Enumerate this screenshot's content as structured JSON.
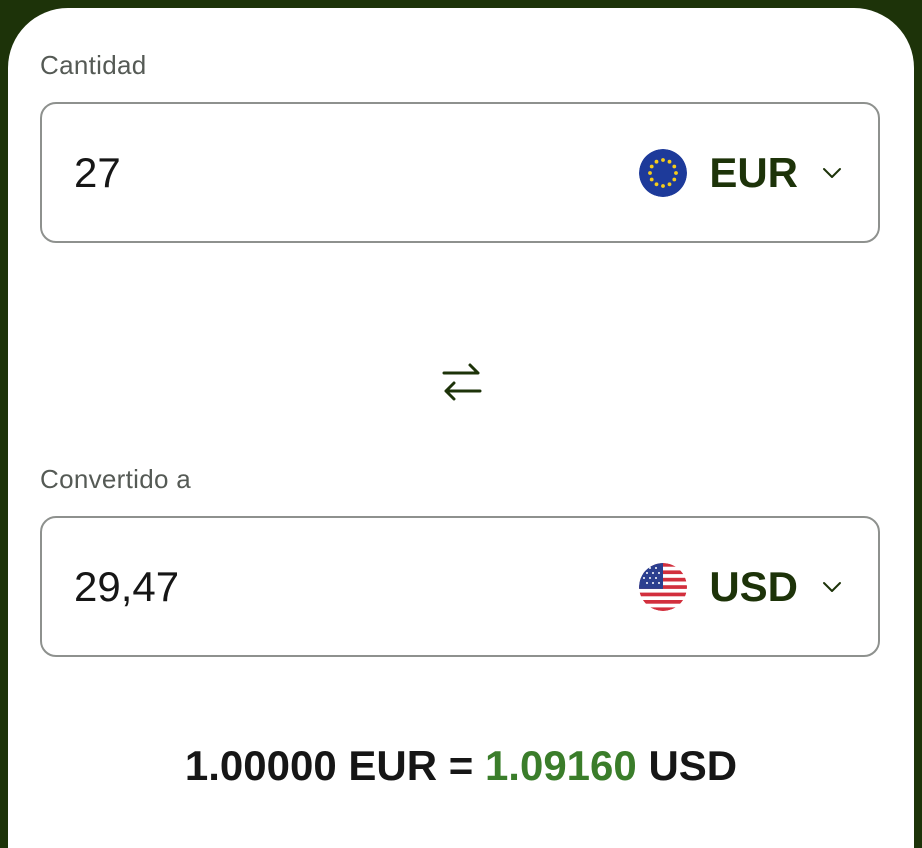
{
  "from": {
    "label": "Cantidad",
    "amount": "27",
    "currency": "EUR",
    "flag_icon": "eu-flag-icon"
  },
  "swap": {
    "icon": "swap-arrows-icon"
  },
  "to": {
    "label": "Convertido a",
    "amount": "29,47",
    "currency": "USD",
    "flag_icon": "us-flag-icon"
  },
  "rate": {
    "base_amount": "1.00000",
    "base_currency": "EUR",
    "equals": "=",
    "quote_amount": "1.09160",
    "quote_currency": "USD"
  },
  "colors": {
    "background": "#1d3309",
    "card": "#ffffff",
    "accent_text": "#1d3309",
    "rate_highlight": "#3a7d2a",
    "border": "#8e918e"
  }
}
